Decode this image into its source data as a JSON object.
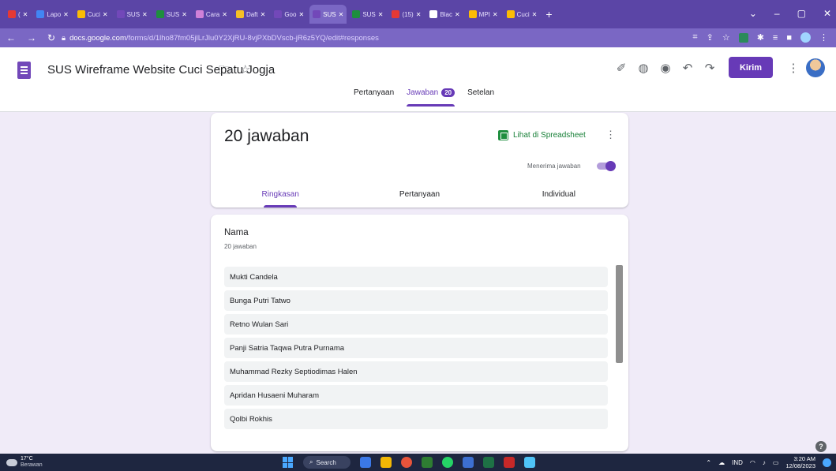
{
  "browser": {
    "tabs": [
      {
        "label": "(",
        "color": "#e53935"
      },
      {
        "label": "Lapo",
        "color": "#4285f4"
      },
      {
        "label": "Cuci",
        "color": "#fbbc04"
      },
      {
        "label": "SUS",
        "color": "#7248b9"
      },
      {
        "label": "SUS",
        "color": "#1e8e3e"
      },
      {
        "label": "Cara",
        "color": "#d081d8"
      },
      {
        "label": "Daft",
        "color": "#f6c026"
      },
      {
        "label": "Goo",
        "color": "#7248b9"
      },
      {
        "label": "SUS",
        "color": "#7248b9",
        "active": true
      },
      {
        "label": "SUS",
        "color": "#1e8e3e"
      },
      {
        "label": "(15)",
        "color": "#e53935"
      },
      {
        "label": "Blac",
        "color": "#ffffff"
      },
      {
        "label": "MPI",
        "color": "#fbbc04"
      },
      {
        "label": "Cuci",
        "color": "#fbbc04"
      }
    ],
    "new_tab": "+",
    "url_host": "docs.google.com",
    "url_path": "/forms/d/1lho87fm05jlLrJlu0Y2XjRU-8vjPXbDVscb-jR6z5YQ/edit#responses"
  },
  "header": {
    "title": "SUS Wireframe Website Cuci Sepatu Jogja",
    "send_label": "Kirim",
    "tabs": {
      "questions": "Pertanyaan",
      "responses": "Jawaban",
      "responses_count": "20",
      "settings": "Setelan"
    }
  },
  "summary": {
    "count_label": "20 jawaban",
    "sheet_link": "Lihat di Spreadsheet",
    "accepting_label": "Menerima jawaban",
    "accepting": true,
    "sub_tabs": {
      "summary": "Ringkasan",
      "question": "Pertanyaan",
      "individual": "Individual"
    }
  },
  "question": {
    "title": "Nama",
    "count": "20 jawaban",
    "answers": [
      "Mukti Candela",
      "Bunga Putri Tatwo",
      "Retno Wulan Sari",
      "Panji Satria Taqwa Putra Purnama",
      "Muhammad Rezky Septiodimas Halen",
      "Apridan Husaeni Muharam",
      "Qolbi Rokhis"
    ]
  },
  "taskbar": {
    "temperature": "17°C",
    "condition": "Berawan",
    "search_label": "Search",
    "language": "IND",
    "time": "3:20 AM",
    "date": "12/08/2023"
  },
  "colors": {
    "accent": "#673ab7",
    "page_bg": "#f0ebf8",
    "sheets_green": "#188038"
  }
}
